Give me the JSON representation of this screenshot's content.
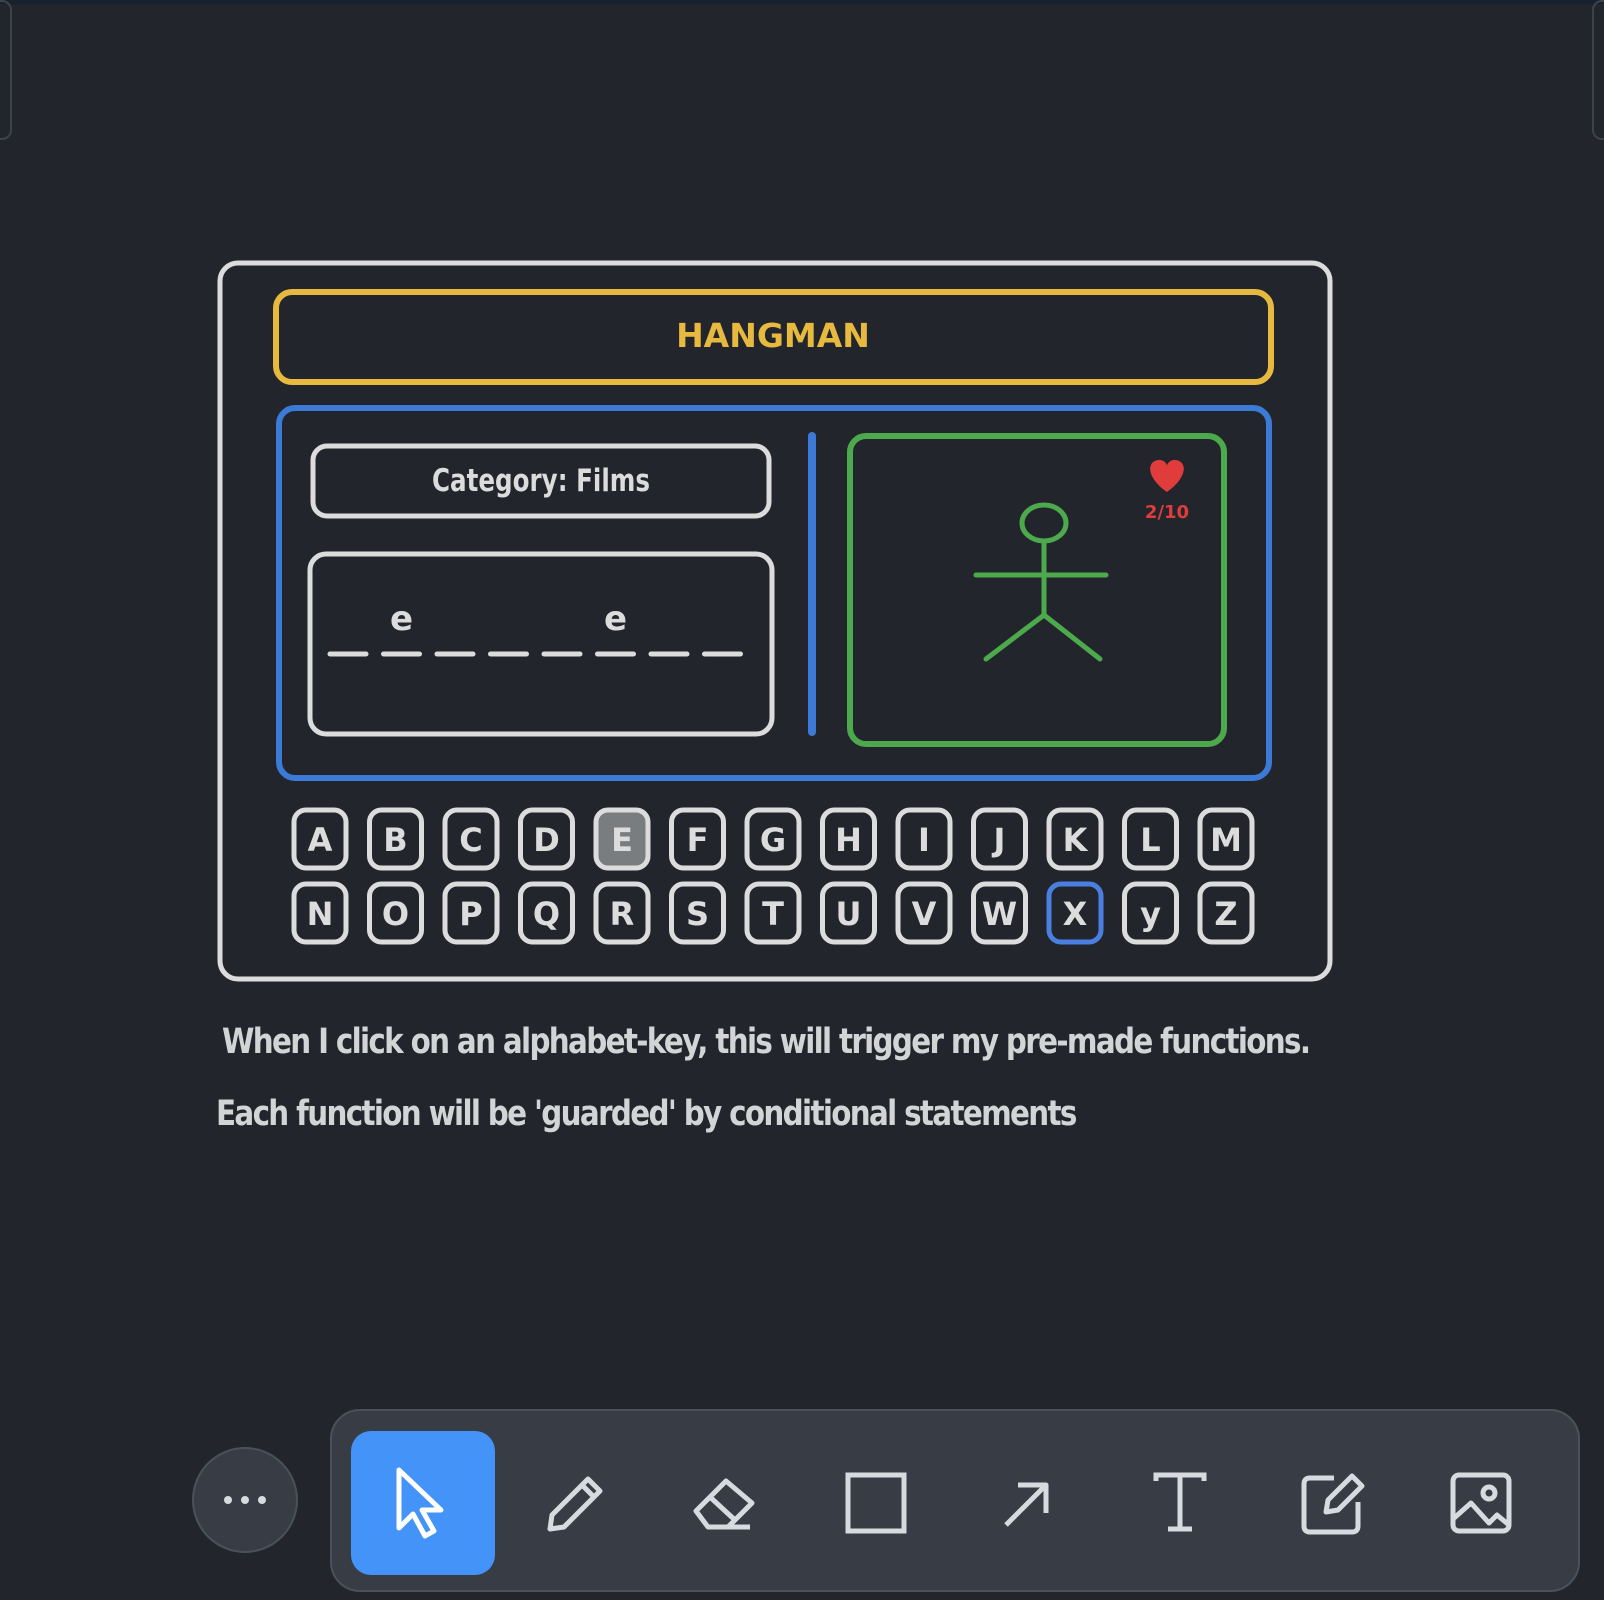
{
  "canvas": {
    "background": "#22262c"
  },
  "diagram": {
    "title": "HANGMAN",
    "category_label": "Category: Films",
    "word": [
      "",
      "e",
      "",
      "",
      "",
      "e",
      "",
      ""
    ],
    "lives": "2/10",
    "keys_row1": [
      "A",
      "B",
      "C",
      "D",
      "E",
      "F",
      "G",
      "H",
      "I",
      "J",
      "K",
      "L",
      "M"
    ],
    "keys_row2": [
      "N",
      "O",
      "P",
      "Q",
      "R",
      "S",
      "T",
      "U",
      "V",
      "W",
      "X",
      "y",
      "Z"
    ],
    "used_key": "E",
    "selected_key": "X",
    "colors": {
      "frame": "#dcdcdc",
      "title_box": "#e8b93f",
      "main_box": "#3b7ad6",
      "hangman_box": "#4caa4c",
      "heart": "#e03c3c",
      "used_key_fill": "#7a7d80",
      "selected_key_border": "#4a7fe0"
    }
  },
  "captions": {
    "line1": "When I click on an alphabet-key,  this will trigger my pre-made functions.",
    "line2": "Each function will be 'guarded' by conditional statements"
  },
  "toolbar": {
    "more_icon": "more-horizontal-icon",
    "tools": [
      {
        "name": "select",
        "icon": "pointer-icon",
        "active": true
      },
      {
        "name": "draw",
        "icon": "pencil-icon",
        "active": false
      },
      {
        "name": "eraser",
        "icon": "eraser-icon",
        "active": false
      },
      {
        "name": "rectangle",
        "icon": "rectangle-icon",
        "active": false
      },
      {
        "name": "arrow",
        "icon": "arrow-icon",
        "active": false
      },
      {
        "name": "text",
        "icon": "text-icon",
        "active": false
      },
      {
        "name": "note",
        "icon": "note-edit-icon",
        "active": false
      },
      {
        "name": "image",
        "icon": "image-icon",
        "active": false
      }
    ],
    "accent": "#4493f8"
  }
}
